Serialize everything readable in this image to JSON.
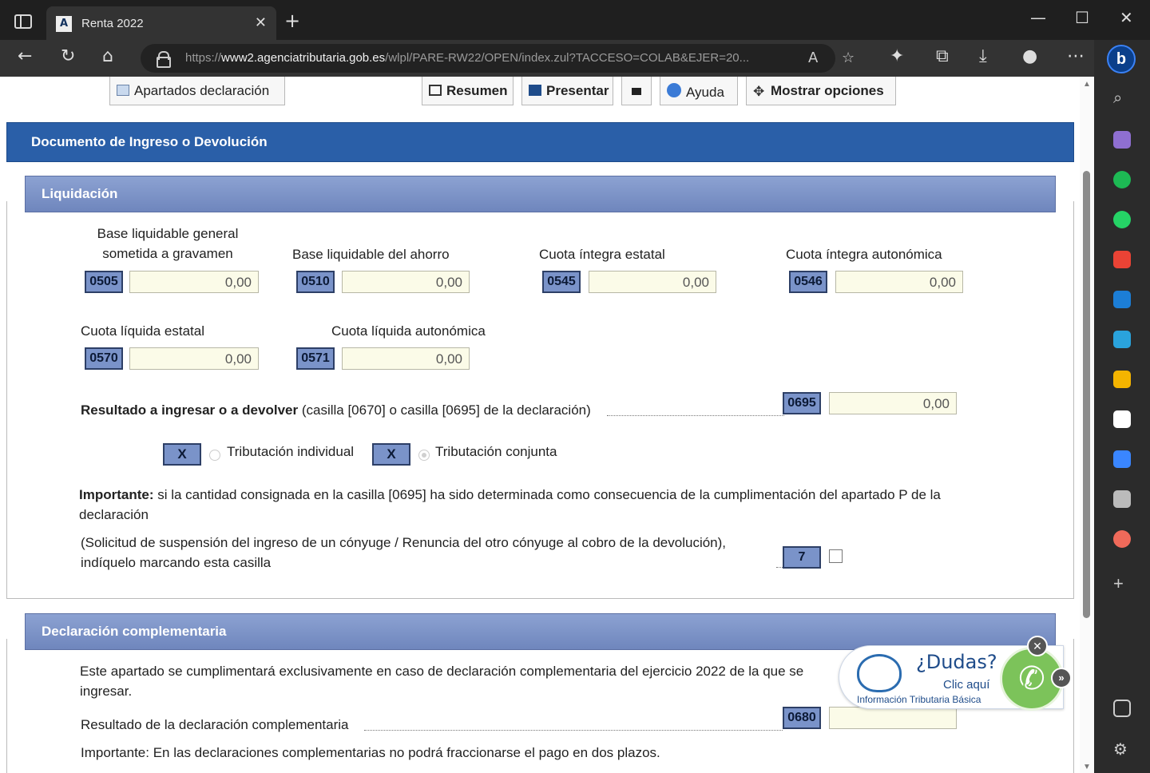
{
  "browser": {
    "tab_title": "Renta 2022",
    "tab_close": "✕",
    "new_tab": "+",
    "url_prefix": "https://",
    "url_host": "www2.agenciatributaria.gob.es",
    "url_rest": "/wlpl/PARE-RW22/OPEN/index.zul?TACCESO=COLAB&EJER=20..."
  },
  "toolbar": {
    "apartados": "Apartados declaración",
    "resumen": "Resumen",
    "presentar": "Presentar",
    "ayuda": "Ayuda",
    "mostrar": "Mostrar opciones"
  },
  "doc_title": "Documento de Ingreso o Devolución",
  "liquidacion": {
    "header": "Liquidación",
    "fields": [
      {
        "label": "Base liquidable general sometida a gravamen",
        "code": "0505",
        "value": "0,00"
      },
      {
        "label": "Base liquidable del ahorro",
        "code": "0510",
        "value": "0,00"
      },
      {
        "label": "Cuota íntegra estatal",
        "code": "0545",
        "value": "0,00"
      },
      {
        "label": "Cuota íntegra autonómica",
        "code": "0546",
        "value": "0,00"
      },
      {
        "label": "Cuota líquida estatal",
        "code": "0570",
        "value": "0,00"
      },
      {
        "label": "Cuota líquida autonómica",
        "code": "0571",
        "value": "0,00"
      }
    ],
    "resultado_bold": "Resultado a ingresar o a devolver",
    "resultado_rest": " (casilla [0670] o casilla [0695] de la declaración)",
    "resultado_code": "0695",
    "resultado_value": "0,00",
    "x_mark": "X",
    "trib_individual": "Tributación individual",
    "trib_conjunta": "Tributación conjunta",
    "importante_bold": "Importante:",
    "importante_text": " si la cantidad consignada en la casilla [0695] ha sido determinada como consecuencia de la cumplimentación del apartado P de la declaración",
    "solicitud_text": "(Solicitud de suspensión del ingreso de un cónyuge / Renuncia del otro cónyuge al cobro de la devolución), indíquelo marcando esta casilla",
    "casilla_code": "7"
  },
  "complementaria": {
    "header": "Declaración complementaria",
    "text": "Este apartado se cumplimentará exclusivamente en caso de declaración complementaria del ejercicio 2022 de la que se",
    "text2": "ingresar.",
    "resultado_label": "Resultado de la declaración complementaria",
    "code": "0680",
    "value": "",
    "importante": "Importante: En las declaraciones complementarias no podrá fraccionarse el pago en dos plazos."
  },
  "dudas": {
    "title": "¿Dudas?",
    "sub": "Clic aquí",
    "info": "Información Tributaria Básica"
  },
  "colors": {
    "blue_header": "#2a5fa8",
    "section_header": "#7a8fc4",
    "code_box": "#7a93c9",
    "field_bg": "#fbfbe8"
  }
}
